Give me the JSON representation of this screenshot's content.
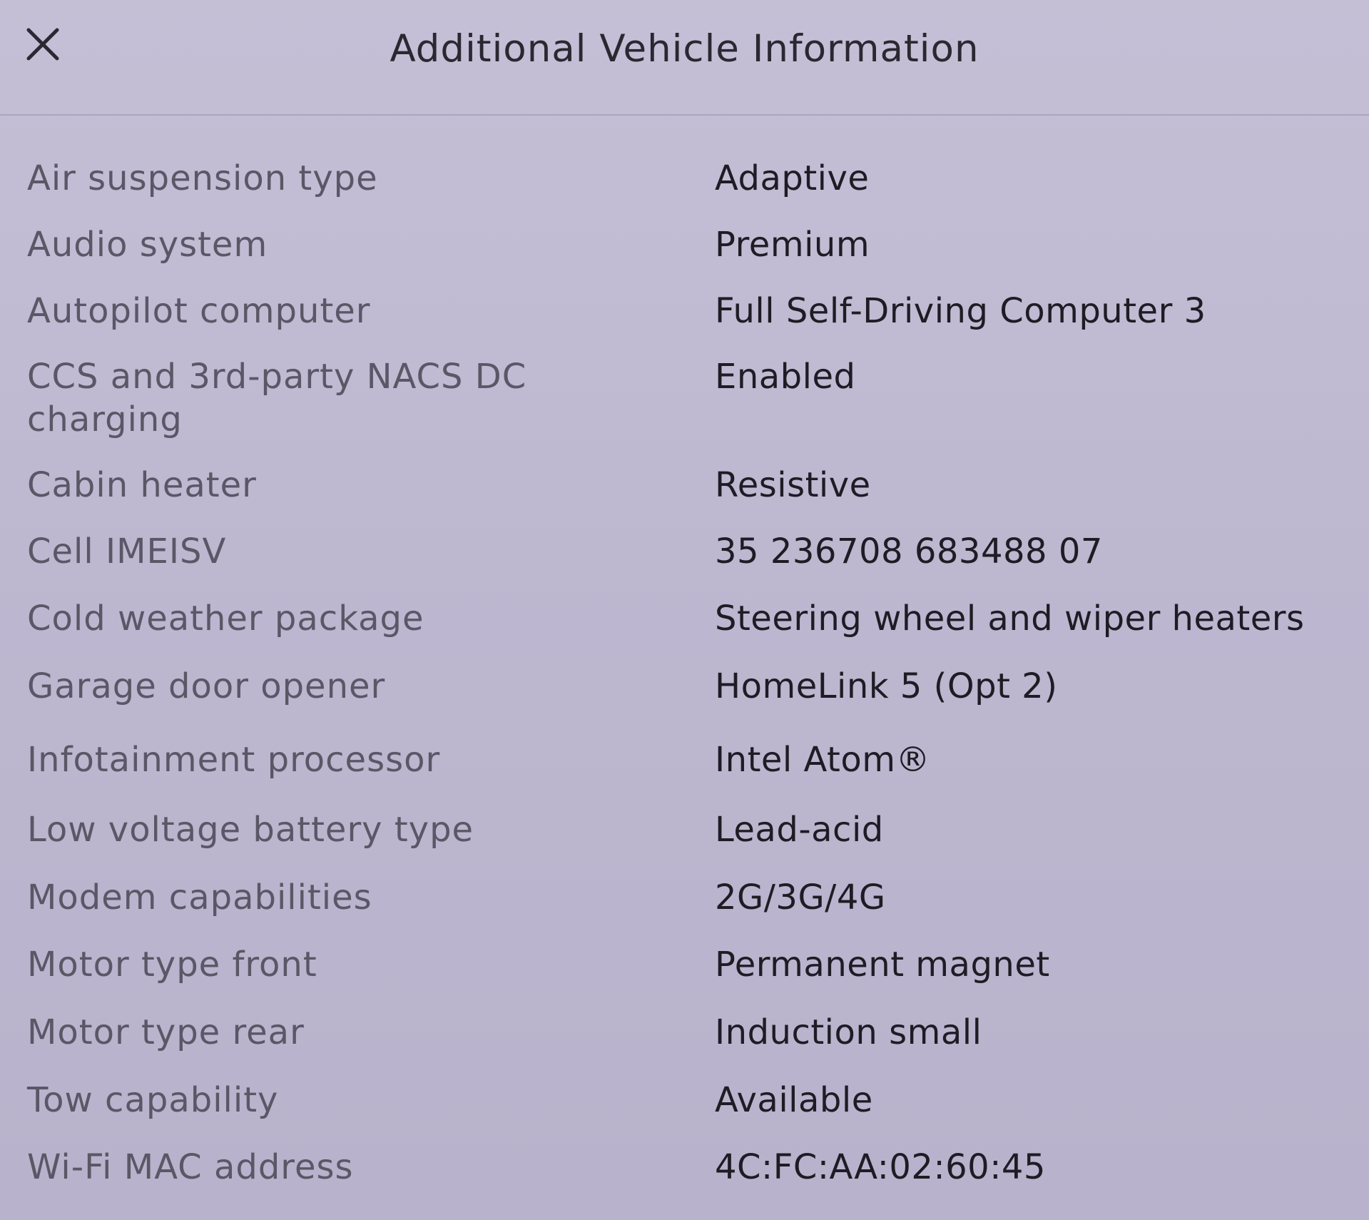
{
  "dialog": {
    "title": "Additional Vehicle Information",
    "close_icon": "close-icon"
  },
  "rows": [
    {
      "label": "Air suspension type",
      "value": "Adaptive"
    },
    {
      "label": "Audio system",
      "value": "Premium"
    },
    {
      "label": "Autopilot computer",
      "value": "Full Self-Driving Computer 3"
    },
    {
      "label": "CCS and 3rd-party NACS DC charging",
      "value": "Enabled"
    },
    {
      "label": "Cabin heater",
      "value": "Resistive"
    },
    {
      "label": "Cell IMEISV",
      "value": "35 236708 683488 07"
    },
    {
      "label": "Cold weather package",
      "value": "Steering wheel and wiper heaters"
    },
    {
      "label": "Garage door opener",
      "value": "HomeLink 5 (Opt 2)"
    },
    {
      "label": "Infotainment processor",
      "value": "Intel Atom®"
    },
    {
      "label": "Low voltage battery type",
      "value": "Lead-acid"
    },
    {
      "label": "Modem capabilities",
      "value": "2G/3G/4G"
    },
    {
      "label": "Motor type front",
      "value": "Permanent magnet"
    },
    {
      "label": "Motor type rear",
      "value": "Induction small"
    },
    {
      "label": "Tow capability",
      "value": "Available"
    },
    {
      "label": "Wi-Fi MAC address",
      "value": "4C:FC:AA:02:60:45"
    }
  ]
}
